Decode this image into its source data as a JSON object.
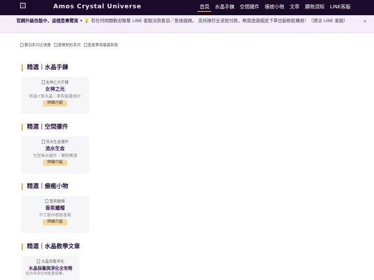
{
  "header": {
    "brand_name": "Amos Crystal Universe",
    "nav": [
      "首頁",
      "水晶手鍊",
      "空間擺件",
      "療癒小物",
      "文章",
      "購物須知",
      "LINE客服"
    ]
  },
  "notice": {
    "bold": "官網升級改版中，這裡是專覽頁 •",
    "text": "💡 有任何問題歡迎聯繫 LINE 客服洽詢售前／售後服務。 支持操作全流程付款，無需透過蝦皮下單也能輕鬆購買！（請洽 LINE 客服）",
    "close": "×"
  },
  "banners": [
    "賽羽系列主視覺",
    "靈聲契約系列",
    "皇家夢境春夏新款"
  ],
  "sections": [
    {
      "title": "精選｜水晶手鍊",
      "img_alt": "女神之光手鍊",
      "name": "女神之光",
      "desc": "粉晶+紫水晶｜柔和能量設計",
      "button": "詳細介紹"
    },
    {
      "title": "精選｜空間擺件",
      "img_alt": "流水生金擺件",
      "name": "流水生金",
      "desc": "大型風水擺件｜聚財開運",
      "button": "詳細介紹"
    },
    {
      "title": "精選｜療癒小物",
      "img_alt": "香氛蠟燭",
      "name": "香氛蠟燭",
      "desc": "手工製作療癒香氣",
      "button": "詳細介紹"
    },
    {
      "title": "精選｜水晶教學文章"
    }
  ],
  "article": {
    "img_alt": "水晶保養淨化",
    "title": "水晶保養與淨化全攻略",
    "desc": "從日常淨化到能量保養，"
  }
}
